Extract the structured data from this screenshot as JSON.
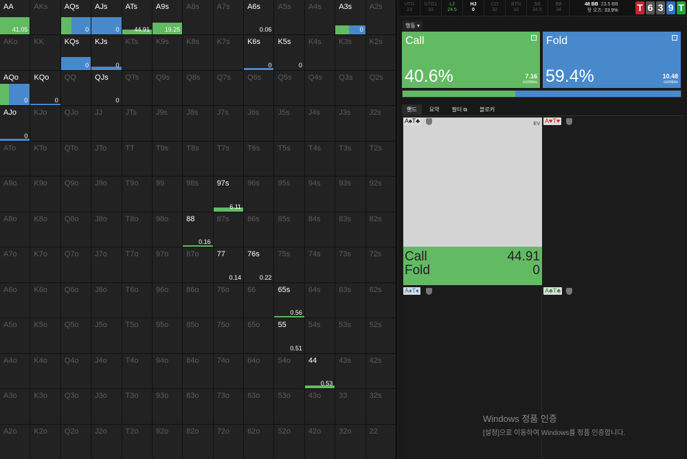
{
  "colors": {
    "call": "#62ba63",
    "fold": "#4889cc",
    "cell_bg": "#222222"
  },
  "topbar": {
    "positions": [
      {
        "name": "UTG",
        "value": "23",
        "style": "dim"
      },
      {
        "name": "UTG1",
        "value": "33",
        "style": "dim"
      },
      {
        "name": "LJ",
        "value": "24.5",
        "style": "lj"
      },
      {
        "name": "HJ",
        "value": "0",
        "style": "hj"
      },
      {
        "name": "CO",
        "value": "32",
        "style": "dim"
      },
      {
        "name": "BTN",
        "value": "33",
        "style": "dim"
      },
      {
        "name": "SB",
        "value": "34.5",
        "style": "dim"
      },
      {
        "name": "BB",
        "value": "34",
        "style": "dim"
      }
    ],
    "stack_bb": "48 BB",
    "stack_right": "23.5 BB",
    "odds_label": "팟 오즈:",
    "odds_value": "33.9%",
    "board": [
      {
        "rank": "T",
        "color": "#c0262d"
      },
      {
        "rank": "6",
        "color": "#555555"
      },
      {
        "rank": "3",
        "color": "#555555"
      },
      {
        "rank": "9",
        "color": "#2f6fcc"
      },
      {
        "rank": "T",
        "color": "#24a23c"
      }
    ]
  },
  "actions": {
    "dropdown_label": "행동 ▾",
    "call": {
      "label": "Call",
      "pct": "40.6%",
      "combos": "7.16",
      "combos_label": "combos",
      "freq": 0.406
    },
    "fold": {
      "label": "Fold",
      "pct": "59.4%",
      "combos": "10.48",
      "combos_label": "combos",
      "freq": 0.594
    }
  },
  "tabs": [
    "핸드",
    "요약",
    "필터 ⧉",
    "블로커"
  ],
  "combo_panels": {
    "main_label": "A♠T♣",
    "main_ev_label": "EV",
    "call_label": "Call",
    "call_ev": "44.91",
    "fold_label": "Fold",
    "fold_ev": "0",
    "right_label": "A♥T♥",
    "bottom_left_label": "A♦T♦",
    "bottom_right_label": "A♣T♣"
  },
  "watermark": {
    "title": "Windows 정품 인증",
    "sub": "[설정]으로 이동하여 Windows를 정품 인증합니다."
  },
  "matrix": [
    [
      {
        "h": "AA",
        "call": 1,
        "ev": "41.05"
      },
      {
        "h": "AKs"
      },
      {
        "h": "AQs",
        "call": 0.35,
        "fold": 0.65,
        "ev": "0"
      },
      {
        "h": "AJs",
        "fold": 1,
        "ev": "0"
      },
      {
        "h": "ATs",
        "call": 1,
        "ev": "44.91",
        "barh": 0.15
      },
      {
        "h": "A9s",
        "call": 1,
        "ev": "19.25",
        "barh": 0.35
      },
      {
        "h": "A8s"
      },
      {
        "h": "A7s"
      },
      {
        "h": "A6s",
        "ev": "0.06",
        "evwhite": 1
      },
      {
        "h": "A5s"
      },
      {
        "h": "A4s"
      },
      {
        "h": "A3s",
        "call": 0.45,
        "fold": 0.55,
        "ev": "0",
        "barh": 0.26
      },
      {
        "h": "A2s"
      }
    ],
    [
      {
        "h": "AKo"
      },
      {
        "h": "KK"
      },
      {
        "h": "KQs",
        "fold": 1,
        "ev": "0",
        "barh": 0.38
      },
      {
        "h": "KJs",
        "fold": 1,
        "ev": "0",
        "barh": 0.1
      },
      {
        "h": "KTs"
      },
      {
        "h": "K9s"
      },
      {
        "h": "K8s"
      },
      {
        "h": "K7s"
      },
      {
        "h": "K6s",
        "fold": 1,
        "ev": "0",
        "barh": 0.06
      },
      {
        "h": "K5s",
        "ev": "0",
        "evwhite": 1
      },
      {
        "h": "K4s"
      },
      {
        "h": "K3s"
      },
      {
        "h": "K2s"
      }
    ],
    [
      {
        "h": "AQo",
        "call": 0.3,
        "fold": 0.7,
        "ev": "0",
        "barh": 0.62
      },
      {
        "h": "KQo",
        "fold": 1,
        "ev": "0",
        "barh": 0.05
      },
      {
        "h": "QQ"
      },
      {
        "h": "QJs",
        "ev": "0",
        "evwhite": 1
      },
      {
        "h": "QTs"
      },
      {
        "h": "Q9s"
      },
      {
        "h": "Q8s"
      },
      {
        "h": "Q7s"
      },
      {
        "h": "Q6s"
      },
      {
        "h": "Q5s"
      },
      {
        "h": "Q4s"
      },
      {
        "h": "Q3s"
      },
      {
        "h": "Q2s"
      }
    ],
    [
      {
        "h": "AJo",
        "fold": 1,
        "ev": "0",
        "barh": 0.05
      },
      {
        "h": "KJo"
      },
      {
        "h": "QJo"
      },
      {
        "h": "JJ"
      },
      {
        "h": "JTs"
      },
      {
        "h": "J9s"
      },
      {
        "h": "J8s"
      },
      {
        "h": "J7s"
      },
      {
        "h": "J6s"
      },
      {
        "h": "J5s"
      },
      {
        "h": "J4s"
      },
      {
        "h": "J3s"
      },
      {
        "h": "J2s"
      }
    ],
    [
      {
        "h": "ATo"
      },
      {
        "h": "KTo"
      },
      {
        "h": "QTo"
      },
      {
        "h": "JTo"
      },
      {
        "h": "TT"
      },
      {
        "h": "T9s"
      },
      {
        "h": "T8s"
      },
      {
        "h": "T7s"
      },
      {
        "h": "T6s"
      },
      {
        "h": "T5s"
      },
      {
        "h": "T4s"
      },
      {
        "h": "T3s"
      },
      {
        "h": "T2s"
      }
    ],
    [
      {
        "h": "A9o"
      },
      {
        "h": "K9o"
      },
      {
        "h": "Q9o"
      },
      {
        "h": "J9o"
      },
      {
        "h": "T9o"
      },
      {
        "h": "99"
      },
      {
        "h": "98s"
      },
      {
        "h": "97s",
        "bright": 1,
        "call": 1,
        "ev": "6.11",
        "barh": 0.12
      },
      {
        "h": "96s"
      },
      {
        "h": "95s"
      },
      {
        "h": "94s"
      },
      {
        "h": "93s"
      },
      {
        "h": "92s"
      }
    ],
    [
      {
        "h": "A8o"
      },
      {
        "h": "K8o"
      },
      {
        "h": "Q8o"
      },
      {
        "h": "J8o"
      },
      {
        "h": "T8o"
      },
      {
        "h": "98o"
      },
      {
        "h": "88",
        "bright": 1,
        "call": 1,
        "ev": "0.16",
        "barh": 0.04
      },
      {
        "h": "87s"
      },
      {
        "h": "86s"
      },
      {
        "h": "85s"
      },
      {
        "h": "84s"
      },
      {
        "h": "83s"
      },
      {
        "h": "82s"
      }
    ],
    [
      {
        "h": "A7o"
      },
      {
        "h": "K7o"
      },
      {
        "h": "Q7o"
      },
      {
        "h": "J7o"
      },
      {
        "h": "T7o"
      },
      {
        "h": "97o"
      },
      {
        "h": "87o"
      },
      {
        "h": "77",
        "bright": 1,
        "ev": "0.14",
        "evwhite": 1
      },
      {
        "h": "76s",
        "bright": 1,
        "ev": "0.22",
        "evwhite": 1
      },
      {
        "h": "75s"
      },
      {
        "h": "74s"
      },
      {
        "h": "73s"
      },
      {
        "h": "72s"
      }
    ],
    [
      {
        "h": "A6o"
      },
      {
        "h": "K6o"
      },
      {
        "h": "Q6o"
      },
      {
        "h": "J6o"
      },
      {
        "h": "T6o"
      },
      {
        "h": "96o"
      },
      {
        "h": "86o"
      },
      {
        "h": "76o"
      },
      {
        "h": "66"
      },
      {
        "h": "65s",
        "bright": 1,
        "call": 1,
        "ev": "0.56",
        "barh": 0.04
      },
      {
        "h": "64s"
      },
      {
        "h": "63s"
      },
      {
        "h": "62s"
      }
    ],
    [
      {
        "h": "A5o"
      },
      {
        "h": "K5o"
      },
      {
        "h": "Q5o"
      },
      {
        "h": "J5o"
      },
      {
        "h": "T5o"
      },
      {
        "h": "95o"
      },
      {
        "h": "85o"
      },
      {
        "h": "75o"
      },
      {
        "h": "65o"
      },
      {
        "h": "55",
        "bright": 1,
        "ev": "0.51",
        "evwhite": 1
      },
      {
        "h": "54s"
      },
      {
        "h": "53s"
      },
      {
        "h": "52s"
      }
    ],
    [
      {
        "h": "A4o"
      },
      {
        "h": "K4o"
      },
      {
        "h": "Q4o"
      },
      {
        "h": "J4o"
      },
      {
        "h": "T4o"
      },
      {
        "h": "94o"
      },
      {
        "h": "84o"
      },
      {
        "h": "74o"
      },
      {
        "h": "64o"
      },
      {
        "h": "54o"
      },
      {
        "h": "44",
        "bright": 1,
        "call": 1,
        "ev": "0.53",
        "barh": 0.08
      },
      {
        "h": "43s"
      },
      {
        "h": "42s"
      }
    ],
    [
      {
        "h": "A3o"
      },
      {
        "h": "K3o"
      },
      {
        "h": "Q3o"
      },
      {
        "h": "J3o"
      },
      {
        "h": "T3o"
      },
      {
        "h": "93o"
      },
      {
        "h": "83o"
      },
      {
        "h": "73o"
      },
      {
        "h": "63o"
      },
      {
        "h": "53o"
      },
      {
        "h": "43o"
      },
      {
        "h": "33"
      },
      {
        "h": "32s"
      }
    ],
    [
      {
        "h": "A2o"
      },
      {
        "h": "K2o"
      },
      {
        "h": "Q2o"
      },
      {
        "h": "J2o"
      },
      {
        "h": "T2o"
      },
      {
        "h": "92o"
      },
      {
        "h": "82o"
      },
      {
        "h": "72o"
      },
      {
        "h": "62o"
      },
      {
        "h": "52o"
      },
      {
        "h": "42o"
      },
      {
        "h": "32o"
      },
      {
        "h": "22"
      }
    ]
  ]
}
